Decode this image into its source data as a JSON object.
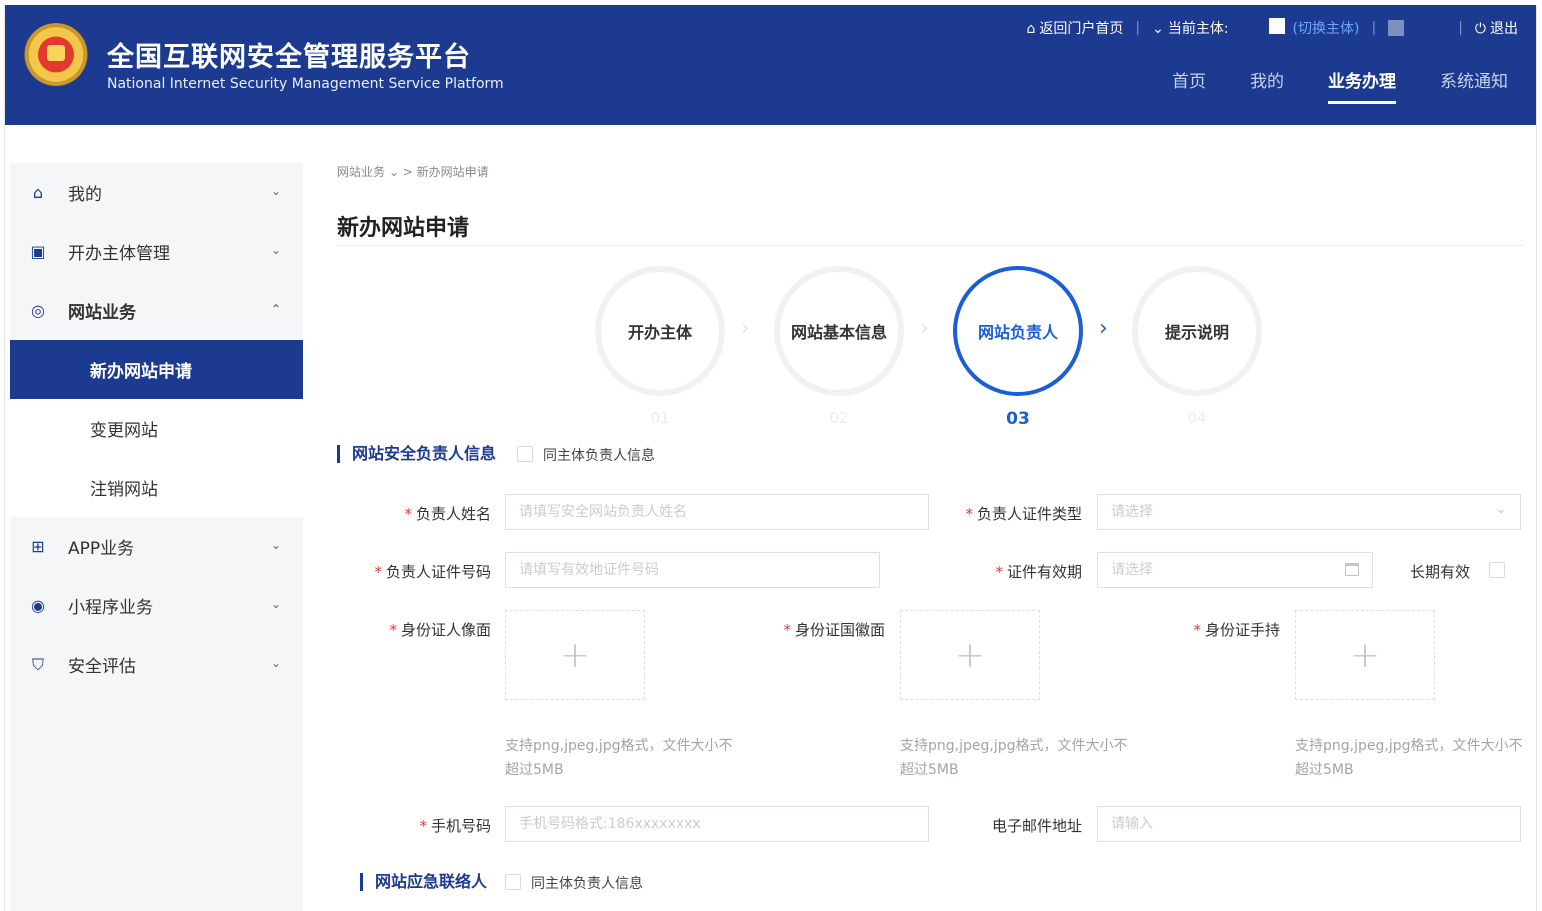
{
  "header": {
    "title_cn": "全国互联网安全管理服务平台",
    "title_en": "National Internet Security Management Service Platform",
    "topbar": {
      "home_link": "返回门户首页",
      "current_subject": "当前主体:",
      "switch_subject": "(切换主体)",
      "logout": "退出"
    },
    "nav": [
      "首页",
      "我的",
      "业务办理",
      "系统通知"
    ]
  },
  "sidebar": {
    "items": [
      {
        "label": "我的",
        "icon": "home-icon"
      },
      {
        "label": "开办主体管理",
        "icon": "briefcase-icon"
      },
      {
        "label": "网站业务",
        "icon": "globe-icon",
        "sub": [
          "新办网站申请",
          "变更网站",
          "注销网站"
        ]
      },
      {
        "label": "APP业务",
        "icon": "grid-icon"
      },
      {
        "label": "小程序业务",
        "icon": "compass-icon"
      },
      {
        "label": "安全评估",
        "icon": "shield-icon"
      }
    ]
  },
  "breadcrumb": {
    "parent": "网站业务",
    "current": "新办网站申请"
  },
  "page_title": "新办网站申请",
  "steps": [
    {
      "label": "开办主体",
      "num": "01"
    },
    {
      "label": "网站基本信息",
      "num": "02"
    },
    {
      "label": "网站负责人",
      "num": "03"
    },
    {
      "label": "提示说明",
      "num": "04"
    }
  ],
  "active_step": 3,
  "security_section": {
    "title": "网站安全负责人信息",
    "same_as_subject": "同主体负责人信息",
    "name_label": "负责人姓名",
    "name_placeholder": "请填写安全网站负责人姓名",
    "id_type_label": "负责人证件类型",
    "id_type_placeholder": "请选择",
    "id_number_label": "负责人证件号码",
    "id_number_placeholder": "请填写有效地证件号码",
    "validity_label": "证件有效期",
    "validity_placeholder": "请选择",
    "long_term": "长期有效",
    "id_front_label": "身份证人像面",
    "id_back_label": "身份证国徽面",
    "id_hand_label": "身份证手持",
    "upload_hint": "支持png,jpeg,jpg格式，文件大小不超过5MB",
    "phone_label": "手机号码",
    "phone_placeholder": "手机号码格式:186xxxxxxxx",
    "email_label": "电子邮件地址",
    "email_placeholder": "请输入"
  },
  "emergency_section": {
    "title": "网站应急联络人",
    "same_as_subject": "同主体负责人信息"
  },
  "colors": {
    "header_bg": "#1c3a8f",
    "accent": "#1c5ed8",
    "required": "#e4393c"
  }
}
